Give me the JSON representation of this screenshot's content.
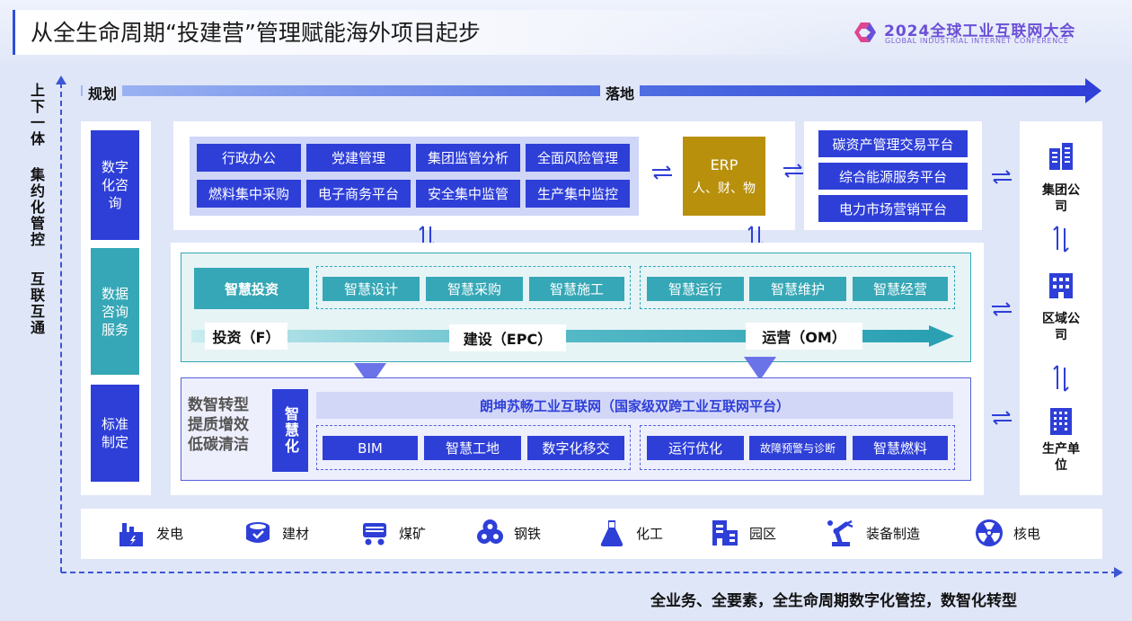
{
  "header": {
    "title": "从全生命周期“投建营”管理赋能海外项目起步",
    "conference_title": "2024全球工业互联网大会",
    "conference_subtitle": "GLOBAL INDUSTRIAL INTERNET CONFERENCE"
  },
  "side_text": [
    "上下一体",
    "集约化管控",
    "互联互通"
  ],
  "process_arrow": {
    "start": "规划",
    "end": "落地"
  },
  "left_column": [
    "数字化咨询",
    "数据咨询服务",
    "标准制定"
  ],
  "top_modules": [
    [
      "行政办公",
      "党建管理",
      "集团监管分析",
      "全面风险管理"
    ],
    [
      "燃料集中采购",
      "电子商务平台",
      "安全集中监管",
      "生产集中监控"
    ]
  ],
  "erp": {
    "title": "ERP",
    "subtitle": "人、财、物"
  },
  "platforms": [
    "碳资产管理交易平台",
    "综合能源服务平台",
    "电力市场营销平台"
  ],
  "org_levels": [
    "集团公司",
    "区域公司",
    "生产单位"
  ],
  "smart_investment": "智慧投资",
  "smart_construction": [
    "智慧设计",
    "智慧采购",
    "智慧施工"
  ],
  "smart_operation": [
    "智慧运行",
    "智慧维护",
    "智慧经营"
  ],
  "phases": [
    "投资（F）",
    "建设（EPC）",
    "运营（OM）"
  ],
  "digital_transformation": {
    "label_lines": [
      "数智转型",
      "提质增效",
      "低碳清洁"
    ],
    "smart_label": "智慧化",
    "platform_title": "朗坤苏畅工业互联网（国家级双跨工业互联网平台）",
    "construction_items": [
      "BIM",
      "智慧工地",
      "数字化移交"
    ],
    "operation_items": [
      "运行优化",
      "故障预警与诊断",
      "智慧燃料"
    ]
  },
  "industries": [
    {
      "label": "发电",
      "icon": "power-plant-icon"
    },
    {
      "label": "建材",
      "icon": "building-materials-icon"
    },
    {
      "label": "煤矿",
      "icon": "coal-mine-icon"
    },
    {
      "label": "钢铁",
      "icon": "steel-icon"
    },
    {
      "label": "化工",
      "icon": "chemical-flask-icon"
    },
    {
      "label": "园区",
      "icon": "industrial-park-icon"
    },
    {
      "label": "装备制造",
      "icon": "robot-arm-icon"
    },
    {
      "label": "核电",
      "icon": "nuclear-icon"
    }
  ],
  "footer": "全业务、全要素，全生命周期数字化管控，数智化转型",
  "colors": {
    "primary_blue": "#2e3fd8",
    "teal": "#36a7b6",
    "erp_gold": "#b8900c",
    "brand_purple": "#6b4fd6"
  }
}
